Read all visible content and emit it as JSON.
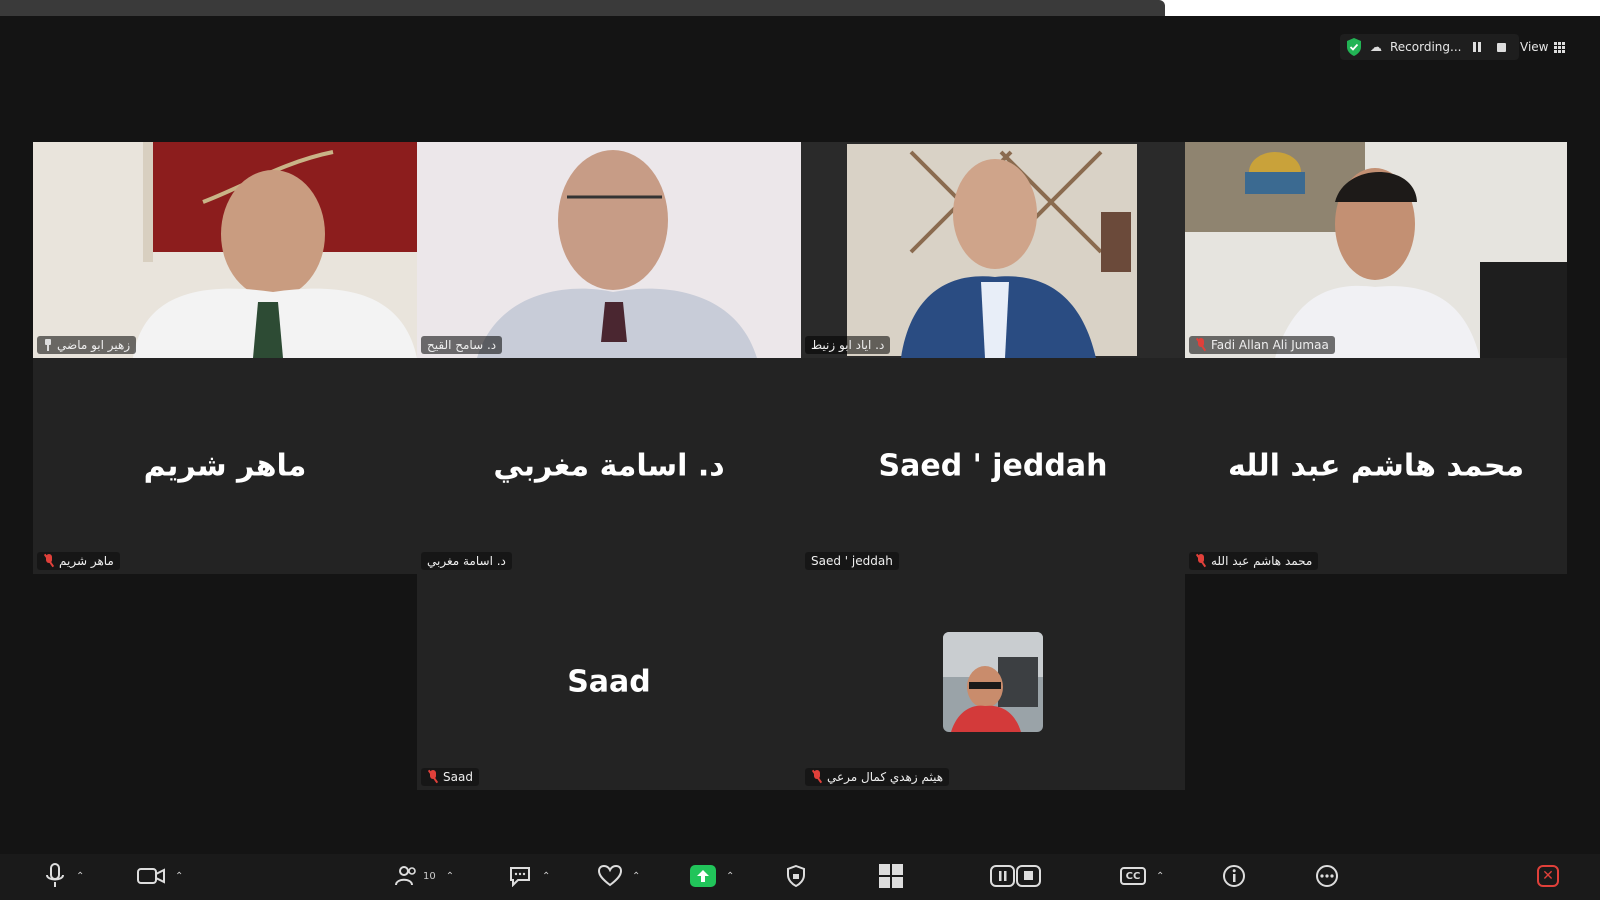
{
  "header": {
    "recording_label": "Recording...",
    "view_label": "View",
    "accent_color": "#1fd16b",
    "recording_icon": "cloud-icon",
    "security_icon": "shield-check-icon"
  },
  "participants": {
    "video": [
      {
        "name": "زهير ابو ماضي",
        "status": "pinned"
      },
      {
        "name": "د. سامح القيح",
        "status": "none"
      },
      {
        "name": "د. اياد ابو زنيط",
        "status": "speaking"
      },
      {
        "name": "Fadi Allan Ali Jumaa",
        "status": "muted"
      }
    ],
    "no_video": [
      {
        "display": "ماهر شريم",
        "tag": "ماهر شريم",
        "status": "muted"
      },
      {
        "display": "د. اسامة مغربي",
        "tag": "د. اسامة مغربي",
        "status": "none"
      },
      {
        "display": "Saed ' jeddah",
        "tag": "Saed ' jeddah",
        "status": "none"
      },
      {
        "display": "محمد هاشم عبد الله",
        "tag": "محمد هاشم عبد الله",
        "status": "muted"
      },
      {
        "display": "Saad",
        "tag": "Saad",
        "status": "muted"
      },
      {
        "display": "",
        "tag": "هيثم زهدي كمال مرعي",
        "status": "muted"
      }
    ]
  },
  "toolbar": {
    "participants_count": "10",
    "items": [
      "microphone-icon",
      "video-camera-icon",
      "participants-icon",
      "chat-icon",
      "reactions-icon",
      "share-screen-icon",
      "security-icon",
      "apps-icon",
      "recording-controls-icon",
      "captions-icon",
      "info-icon",
      "more-icon",
      "end-meeting-icon"
    ],
    "cc_label": "CC",
    "end_color": "#e0403a"
  }
}
